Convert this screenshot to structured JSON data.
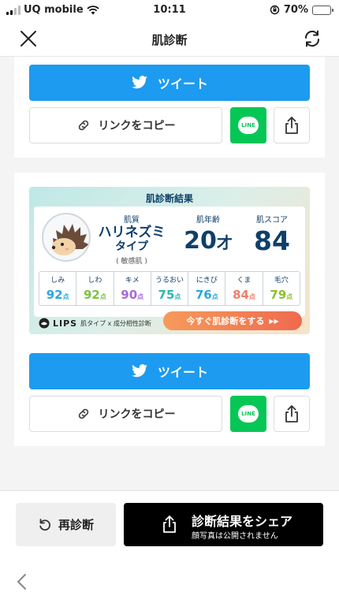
{
  "status_bar": {
    "carrier": "UQ mobile",
    "time": "10:11",
    "battery_percent": "70%",
    "battery_level": 0.7,
    "icons": [
      "signal-icon",
      "wifi-icon",
      "rotation-lock-icon",
      "battery-icon"
    ]
  },
  "nav": {
    "title": "肌診断",
    "close_icon": "close-icon",
    "refresh_icon": "refresh-icon"
  },
  "share": {
    "tweet_label": "ツイート",
    "copy_label": "リンクをコピー",
    "line_label": "LINE"
  },
  "result_card": {
    "title": "肌診断結果",
    "skin_type_label": "肌質",
    "skin_type_line1": "ハリネズミ",
    "skin_type_line2": "タイプ",
    "skin_sub": "( 敏感肌 )",
    "age_label": "肌年齢",
    "age_value": "20",
    "age_unit": "才",
    "score_label": "肌スコア",
    "score_value": "84",
    "metrics": [
      {
        "name": "しみ",
        "value": "92",
        "unit": "点",
        "color": "#2aa7e0"
      },
      {
        "name": "しわ",
        "value": "92",
        "unit": "点",
        "color": "#7dc343"
      },
      {
        "name": "キメ",
        "value": "90",
        "unit": "点",
        "color": "#a56bd6"
      },
      {
        "name": "うるおい",
        "value": "75",
        "unit": "点",
        "color": "#2bb8b0"
      },
      {
        "name": "にきび",
        "value": "76",
        "unit": "点",
        "color": "#2aa7e0"
      },
      {
        "name": "くま",
        "value": "84",
        "unit": "点",
        "color": "#ef7f6a"
      },
      {
        "name": "毛穴",
        "value": "79",
        "unit": "点",
        "color": "#8cbf2e"
      }
    ],
    "brand": "LIPS",
    "brand_tagline": "肌タイプ x 成分相性診断",
    "cta_label": "今すぐ肌診断をする",
    "cta_arrows": "▶▶"
  },
  "bottom": {
    "rediagnose_label": "再診断",
    "share_title": "診断結果をシェア",
    "share_sub": "顔写真は公開されません"
  },
  "colors": {
    "twitter": "#1d9bf0",
    "line": "#06c755",
    "navy": "#0f3f6a"
  }
}
